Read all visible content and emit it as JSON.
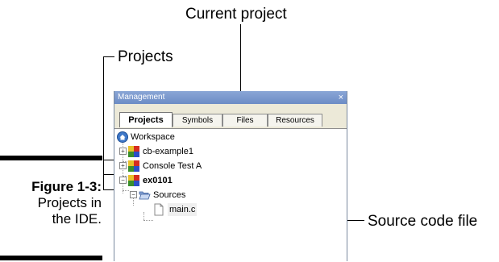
{
  "callouts": {
    "current_project": "Current project",
    "projects": "Projects",
    "source_code_file": "Source code file"
  },
  "caption": {
    "figure": "Figure 1-3:",
    "line1": "Projects in",
    "line2": "the IDE."
  },
  "panel": {
    "title": "Management",
    "close": "×",
    "tabs": [
      {
        "label": "Projects",
        "active": true
      },
      {
        "label": "Symbols",
        "active": false
      },
      {
        "label": "Files",
        "active": false
      },
      {
        "label": "Resources",
        "active": false
      }
    ],
    "tree": {
      "workspace": "Workspace",
      "items": [
        {
          "label": "cb-example1",
          "bold": false
        },
        {
          "label": "Console Test A",
          "bold": false
        },
        {
          "label": "ex0101",
          "bold": true
        }
      ],
      "sources": "Sources",
      "file": "main.c"
    }
  },
  "colors": {
    "titlebar": "#7b97ce",
    "tab_bg": "#ece9d8"
  }
}
